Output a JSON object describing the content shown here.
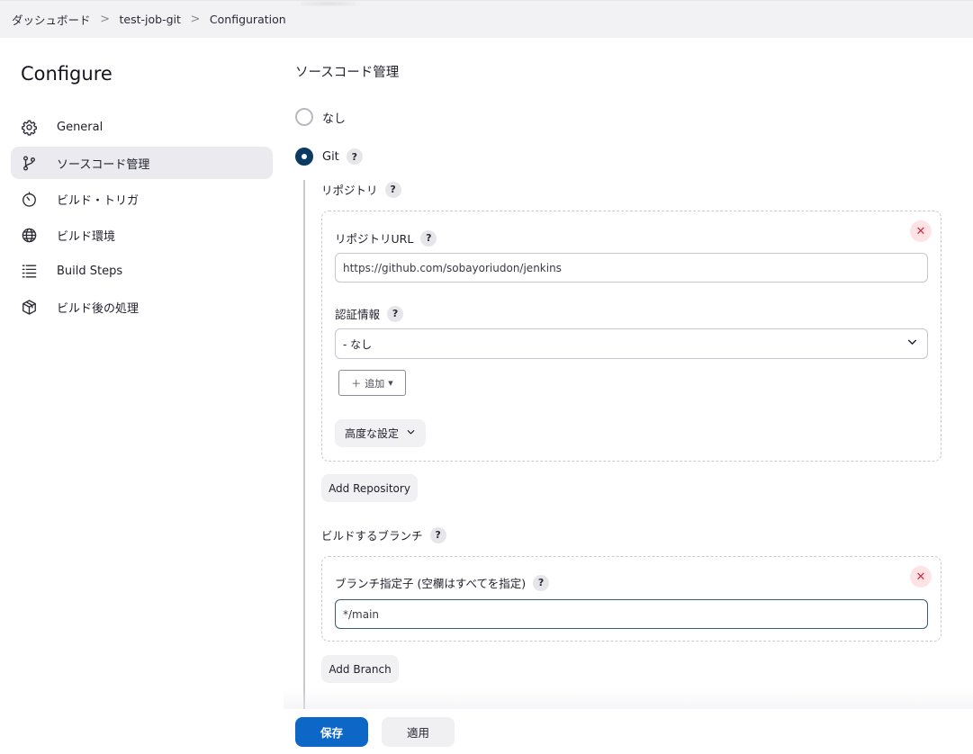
{
  "breadcrumb": {
    "items": [
      "ダッシュボード",
      "test-job-git",
      "Configuration"
    ],
    "separator": ">"
  },
  "sidebar": {
    "title": "Configure",
    "items": [
      {
        "label": "General",
        "icon": "gear-icon",
        "active": false
      },
      {
        "label": "ソースコード管理",
        "icon": "branch-icon",
        "active": true
      },
      {
        "label": "ビルド・トリガ",
        "icon": "timer-icon",
        "active": false
      },
      {
        "label": "ビルド環境",
        "icon": "globe-icon",
        "active": false
      },
      {
        "label": "Build Steps",
        "icon": "list-icon",
        "active": false
      },
      {
        "label": "ビルド後の処理",
        "icon": "package-icon",
        "active": false
      }
    ]
  },
  "scm": {
    "section_title": "ソースコード管理",
    "options": [
      {
        "label": "なし",
        "checked": false
      },
      {
        "label": "Git",
        "checked": true
      }
    ],
    "help_label": "?",
    "repositories_label": "リポジトリ",
    "repository": {
      "url_label": "リポジトリURL",
      "url_value": "https://github.com/sobayoriudon/jenkins",
      "credentials_label": "認証情報",
      "credentials_value": "- なし",
      "add_button": "追加",
      "advanced_button": "高度な設定"
    },
    "add_repository_button": "Add Repository",
    "branches_label": "ビルドするブランチ",
    "branch": {
      "specifier_label": "ブランチ指定子 (空欄はすべてを指定)",
      "specifier_value": "*/main"
    },
    "add_branch_button": "Add Branch"
  },
  "footer": {
    "save_button": "保存",
    "apply_button": "適用"
  },
  "colors": {
    "primary": "#0d67c7",
    "radio_checked": "#0b3a64",
    "remove": "#d42a3a",
    "sidebar_active_bg": "#ebebef"
  }
}
